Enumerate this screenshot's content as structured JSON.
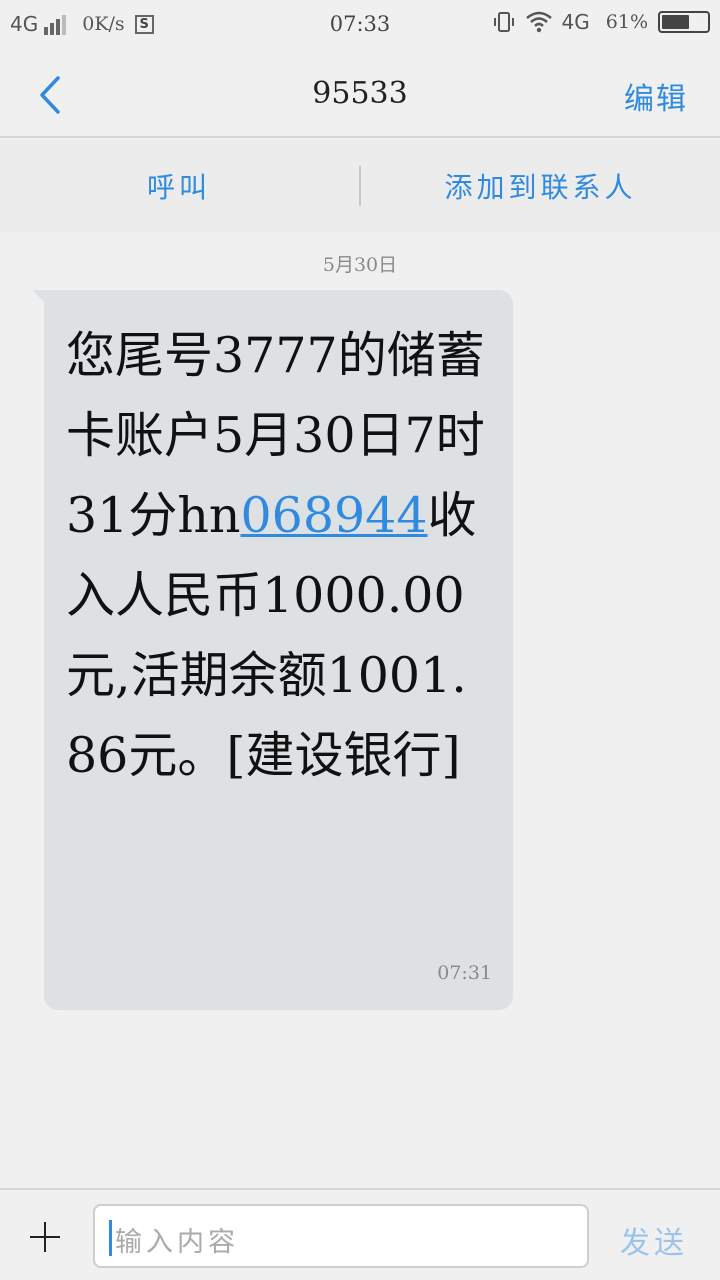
{
  "status_bar": {
    "network": "4G",
    "speed": "0K/s",
    "s_badge": "S",
    "time": "07:33",
    "network_right": "4G",
    "battery_percent": "61%",
    "battery_level": 0.61
  },
  "header": {
    "title": "95533",
    "edit_label": "编辑"
  },
  "actions": {
    "call_label": "呼叫",
    "add_contact_label": "添加到联系人"
  },
  "conversation": {
    "date": "5月30日",
    "message": {
      "text_before_link": "您尾号3777的储蓄卡账户5月30日7时31分hn",
      "link": "068944",
      "text_after_link": "收入人民币1000.00元,活期余额1001.86元。[建设银行]",
      "time": "07:31"
    }
  },
  "composer": {
    "placeholder": "输入内容",
    "send_label": "发送"
  },
  "colors": {
    "accent": "#2f8ae0",
    "bubble": "#dde1e4",
    "background": "#f0f0f0"
  },
  "icons": {
    "back": "chevron-left-icon",
    "add": "plus-icon",
    "vibrate": "vibrate-icon",
    "wifi": "wifi-icon",
    "battery": "battery-icon",
    "signal": "signal-icon"
  }
}
